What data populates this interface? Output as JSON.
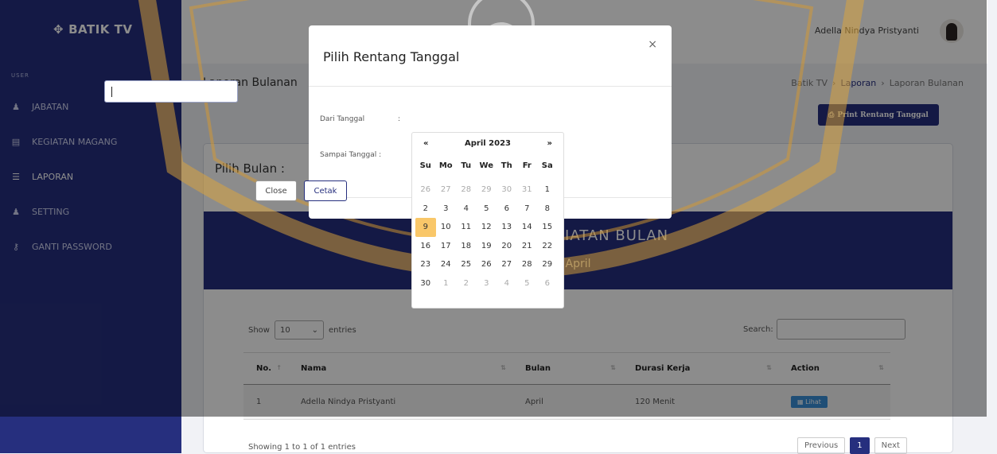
{
  "app": {
    "brand": "BATIK TV"
  },
  "sidebar": {
    "section": "USER",
    "items": [
      {
        "label": "JABATAN",
        "icon": "user-tie-icon",
        "glyph": "♟"
      },
      {
        "label": "KEGIATAN MAGANG",
        "icon": "calendar-icon",
        "glyph": "▤"
      },
      {
        "label": "LAPORAN",
        "icon": "list-icon",
        "glyph": "☰"
      },
      {
        "label": "SETTING",
        "icon": "user-cog-icon",
        "glyph": "♟"
      },
      {
        "label": "GANTI PASSWORD",
        "icon": "key-icon",
        "glyph": "⚷"
      }
    ]
  },
  "header": {
    "user_name": "Adella Nindya Pristyanti"
  },
  "page": {
    "title": "Laporan Bulanan",
    "breadcrumb": [
      "Batik TV",
      "Laporan",
      "Laporan Bulanan"
    ],
    "print_button": "Print Rentang Tanggal"
  },
  "card": {
    "title": "Pilih Bulan :",
    "banner_title": "DATA KEGIATAN BULAN",
    "banner_sub": "April"
  },
  "table": {
    "show_label": "Show",
    "entries_value": "10",
    "entries_label": "entries",
    "search_label": "Search:",
    "columns": [
      "No.",
      "Nama",
      "Bulan",
      "Durasi Kerja",
      "Action"
    ],
    "rows": [
      {
        "no": "1",
        "nama": "Adella Nindya Pristyanti",
        "bulan": "April",
        "durasi": "120 Menit",
        "action": "Lihat"
      }
    ],
    "info": "Showing 1 to 1 of 1 entries",
    "pagination": {
      "previous": "Previous",
      "current": "1",
      "next": "Next"
    }
  },
  "modal": {
    "title": "Pilih Rentang Tanggal",
    "close_x": "×",
    "dari_label": "Dari Tanggal",
    "sampai_label": "Sampai Tanggal :",
    "dari_value": "",
    "close_button": "Close",
    "cetak_button": "Cetak"
  },
  "datepicker": {
    "prev": "«",
    "month": "April 2023",
    "next": "»",
    "dow": [
      "Su",
      "Mo",
      "Tu",
      "We",
      "Th",
      "Fr",
      "Sa"
    ],
    "weeks": [
      [
        "26",
        "27",
        "28",
        "29",
        "30",
        "31",
        "1"
      ],
      [
        "2",
        "3",
        "4",
        "5",
        "6",
        "7",
        "8"
      ],
      [
        "9",
        "10",
        "11",
        "12",
        "13",
        "14",
        "15"
      ],
      [
        "16",
        "17",
        "18",
        "19",
        "20",
        "21",
        "22"
      ],
      [
        "23",
        "24",
        "25",
        "26",
        "27",
        "28",
        "29"
      ],
      [
        "30",
        "1",
        "2",
        "3",
        "4",
        "5",
        "6"
      ]
    ],
    "today": "9"
  },
  "colors": {
    "primary": "#262f7e",
    "today": "#f9c769",
    "button_info": "#3a8fd8"
  }
}
